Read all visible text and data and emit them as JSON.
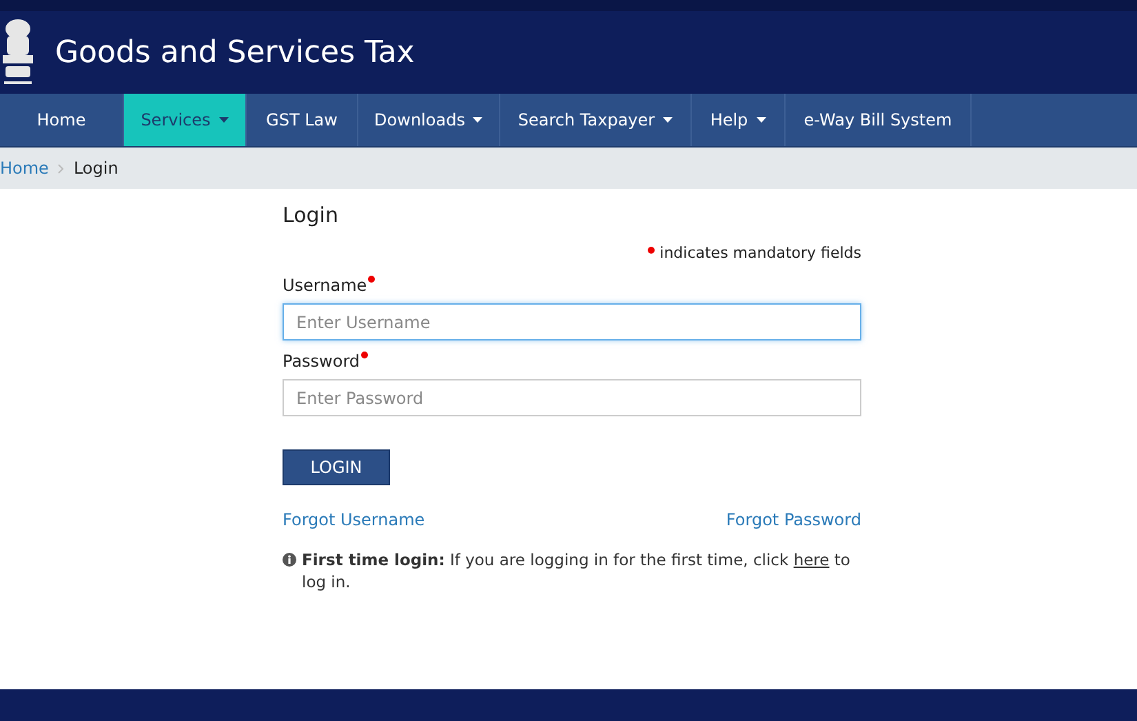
{
  "header": {
    "title": "Goods and Services Tax"
  },
  "nav": [
    {
      "label": "Home",
      "dropdown": false,
      "selected": false
    },
    {
      "label": "Services",
      "dropdown": true,
      "selected": true
    },
    {
      "label": "GST Law",
      "dropdown": false,
      "selected": false
    },
    {
      "label": "Downloads",
      "dropdown": true,
      "selected": false
    },
    {
      "label": "Search Taxpayer",
      "dropdown": true,
      "selected": false
    },
    {
      "label": "Help",
      "dropdown": true,
      "selected": false
    },
    {
      "label": "e-Way Bill System",
      "dropdown": false,
      "selected": false
    }
  ],
  "breadcrumb": [
    "Home",
    "Login"
  ],
  "login": {
    "heading": "Login",
    "mandatory_note": "indicates mandatory fields",
    "fields": [
      {
        "label": "Username",
        "placeholder": "Enter Username",
        "focused": true
      },
      {
        "label": "Password",
        "placeholder": "Enter Password",
        "focused": false
      }
    ],
    "button": "LOGIN",
    "forgot_username": "Forgot Username",
    "forgot_password": "Forgot Password",
    "info": {
      "lead": "First time login:",
      "before": " If you are logging in for the first time, click ",
      "link": "here",
      "after": " to log in."
    }
  }
}
